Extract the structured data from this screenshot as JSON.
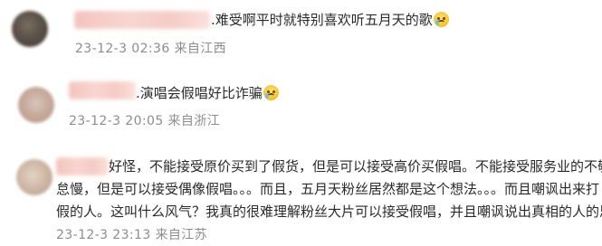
{
  "comments": [
    {
      "text": ".难受啊平时就特别喜欢听五月天的歌",
      "emoji": "crying-face",
      "meta": "23-12-3 02:36 来自江西"
    },
    {
      "text": ".演唱会假唱好比诈骗",
      "emoji": "crying-laughing-face",
      "meta": "23-12-3 20:05 来自浙江"
    },
    {
      "lines": [
        "好怪，不能接受原价买到了假货，但是可以接受高价买假唱。不能接受服务业的不敬业",
        "怠慢，但是可以接受偶像假唱。。。而且，五月天粉丝居然都是这个想法。。。而且嘲讽出来打",
        "假的人。这叫什么风气？我真的很难理解粉丝大片可以接受假唱，并且嘲讽说出真相的人的思维"
      ],
      "meta": "23-12-3 23:13 来自江苏"
    }
  ]
}
